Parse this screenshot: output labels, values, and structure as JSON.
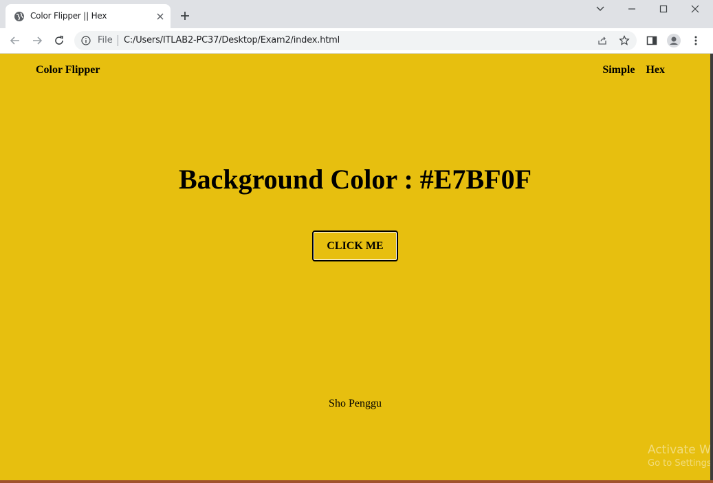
{
  "browser": {
    "tab_title": "Color Flipper || Hex",
    "url_scheme_label": "File",
    "url": "C:/Users/ITLAB2-PC37/Desktop/Exam2/index.html"
  },
  "page": {
    "background_color": "#E7BF0F",
    "brand": "Color Flipper",
    "nav": [
      "Simple",
      "Hex"
    ],
    "heading_prefix": "Background Color : ",
    "heading_color": "#E7BF0F",
    "button_label": "CLICK ME",
    "footer": "Sho Penggu"
  },
  "os_watermark": {
    "line1": "Activate W",
    "line2": "Go to Settings"
  }
}
